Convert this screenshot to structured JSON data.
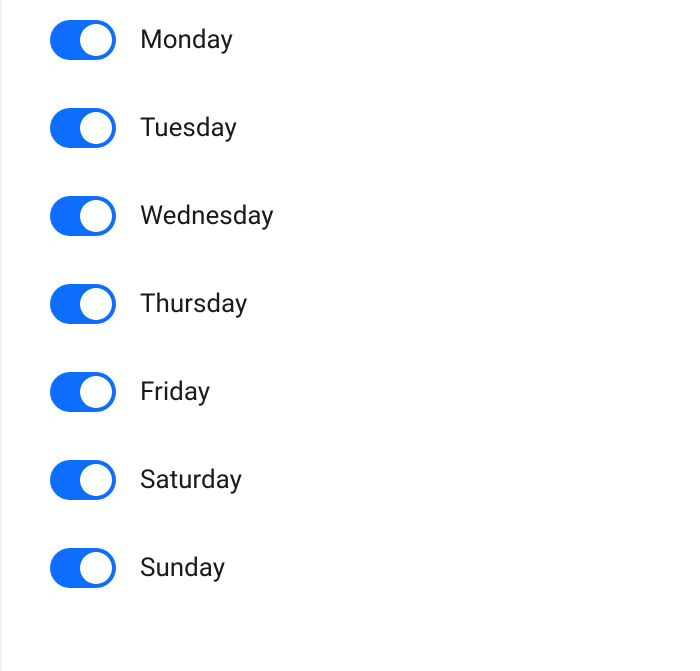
{
  "colors": {
    "toggle_on": "#0d6efd",
    "toggle_off": "#cccccc",
    "knob": "#ffffff",
    "text": "#1a1a1a"
  },
  "days": [
    {
      "label": "Monday",
      "enabled": true
    },
    {
      "label": "Tuesday",
      "enabled": true
    },
    {
      "label": "Wednesday",
      "enabled": true
    },
    {
      "label": "Thursday",
      "enabled": true
    },
    {
      "label": "Friday",
      "enabled": true
    },
    {
      "label": "Saturday",
      "enabled": true
    },
    {
      "label": "Sunday",
      "enabled": true
    }
  ]
}
